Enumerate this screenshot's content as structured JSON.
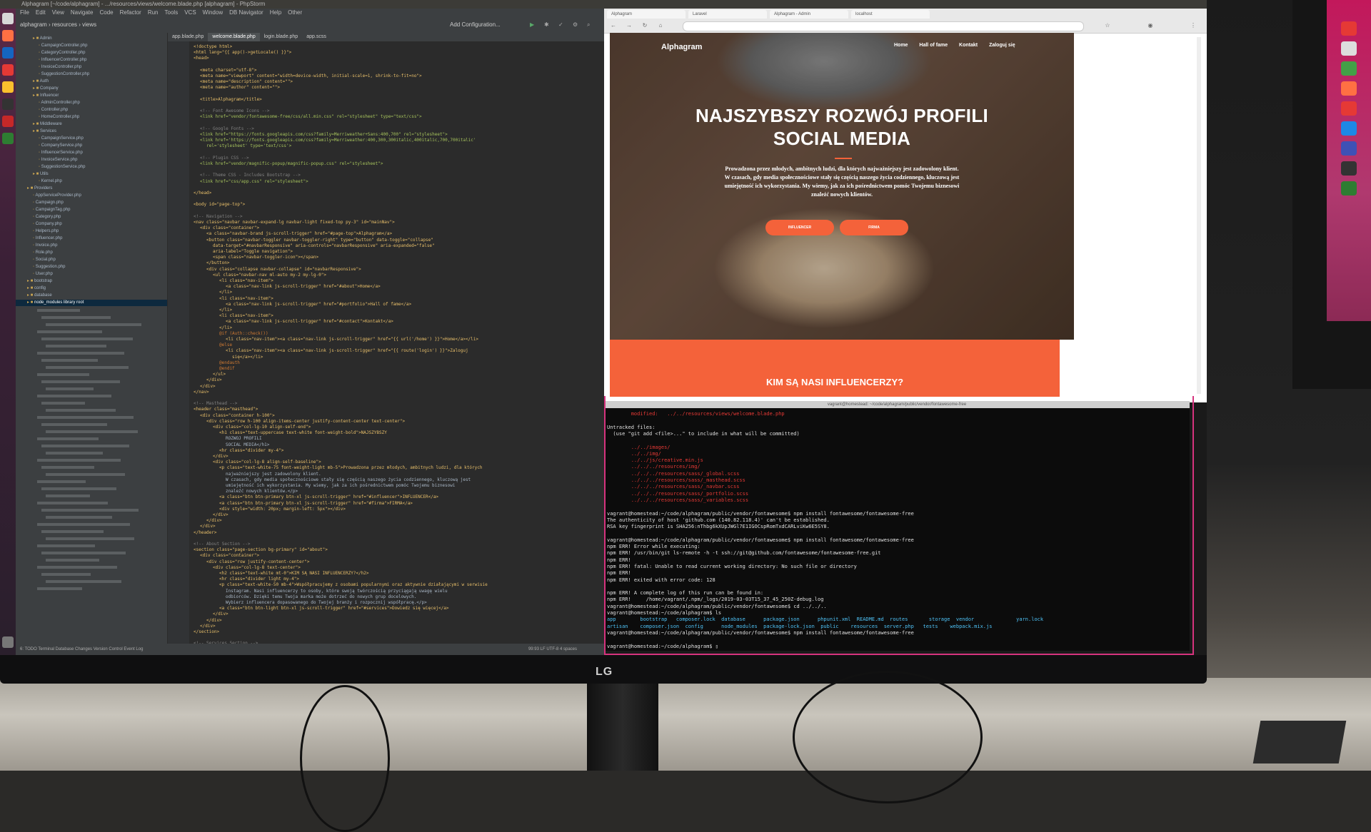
{
  "desktop": {
    "top_bar": "Alphagram [~/code/alphagram] - .../resources/views/welcome.blade.php [alphagram] - PhpStorm"
  },
  "ide": {
    "menu": [
      "File",
      "Edit",
      "View",
      "Navigate",
      "Code",
      "Refactor",
      "Run",
      "Tools",
      "VCS",
      "Window",
      "DB Navigator",
      "Help",
      "Other"
    ],
    "breadcrumb": "alphagram › resources › views",
    "run_config": "Add Configuration...",
    "tabs": [
      "app.blade.php",
      "welcome.blade.php",
      "login.blade.php",
      "app.scss"
    ],
    "project_tree": [
      {
        "label": "Admin",
        "depth": 2,
        "folder": true
      },
      {
        "label": "CampaignController.php",
        "depth": 3
      },
      {
        "label": "CategoryController.php",
        "depth": 3
      },
      {
        "label": "InfluencerController.php",
        "depth": 3
      },
      {
        "label": "InvoiceController.php",
        "depth": 3
      },
      {
        "label": "SuggestionController.php",
        "depth": 3
      },
      {
        "label": "Auth",
        "depth": 2,
        "folder": true
      },
      {
        "label": "Company",
        "depth": 2,
        "folder": true
      },
      {
        "label": "Influencer",
        "depth": 2,
        "folder": true
      },
      {
        "label": "AdminController.php",
        "depth": 3
      },
      {
        "label": "Controller.php",
        "depth": 3
      },
      {
        "label": "HomeController.php",
        "depth": 3
      },
      {
        "label": "Middleware",
        "depth": 2,
        "folder": true
      },
      {
        "label": "Services",
        "depth": 2,
        "folder": true
      },
      {
        "label": "CampaignService.php",
        "depth": 3
      },
      {
        "label": "CompanyService.php",
        "depth": 3
      },
      {
        "label": "InfluencerService.php",
        "depth": 3
      },
      {
        "label": "InvoiceService.php",
        "depth": 3
      },
      {
        "label": "SuggestionService.php",
        "depth": 3
      },
      {
        "label": "Utils",
        "depth": 2,
        "folder": true
      },
      {
        "label": "Kernel.php",
        "depth": 3
      },
      {
        "label": "Providers",
        "depth": 1,
        "folder": true
      },
      {
        "label": "AppServiceProvider.php",
        "depth": 2
      },
      {
        "label": "Campaign.php",
        "depth": 2
      },
      {
        "label": "CampaignTag.php",
        "depth": 2
      },
      {
        "label": "Category.php",
        "depth": 2
      },
      {
        "label": "Company.php",
        "depth": 2
      },
      {
        "label": "Helpers.php",
        "depth": 2
      },
      {
        "label": "Influencer.php",
        "depth": 2
      },
      {
        "label": "Invoice.php",
        "depth": 2
      },
      {
        "label": "Role.php",
        "depth": 2
      },
      {
        "label": "Social.php",
        "depth": 2
      },
      {
        "label": "Suggestion.php",
        "depth": 2
      },
      {
        "label": "User.php",
        "depth": 2
      },
      {
        "label": "bootstrap",
        "depth": 1,
        "folder": true
      },
      {
        "label": "config",
        "depth": 1,
        "folder": true
      },
      {
        "label": "database",
        "depth": 1,
        "folder": true
      },
      {
        "label": "node_modules  library root",
        "depth": 1,
        "folder": true,
        "selected": true
      }
    ],
    "code_lines": [
      {
        "i": 0,
        "t": "<!doctype html>",
        "c": "#e8bf6a"
      },
      {
        "i": 0,
        "t": "<html lang=\"{{ app()->getLocale() }}\">",
        "c": "#e8bf6a"
      },
      {
        "i": 0,
        "t": "<head>",
        "c": "#e8bf6a"
      },
      {
        "i": 0,
        "t": "",
        "c": "#a9b7c6"
      },
      {
        "i": 1,
        "t": "<meta charset=\"utf-8\">",
        "c": "#e8bf6a"
      },
      {
        "i": 1,
        "t": "<meta name=\"viewport\" content=\"width=device-width, initial-scale=1, shrink-to-fit=no\">",
        "c": "#e8bf6a"
      },
      {
        "i": 1,
        "t": "<meta name=\"description\" content=\"\">",
        "c": "#e8bf6a"
      },
      {
        "i": 1,
        "t": "<meta name=\"author\" content=\"\">",
        "c": "#e8bf6a"
      },
      {
        "i": 0,
        "t": "",
        "c": "#a9b7c6"
      },
      {
        "i": 1,
        "t": "<title>Alphagram</title>",
        "c": "#e8bf6a"
      },
      {
        "i": 0,
        "t": "",
        "c": "#a9b7c6"
      },
      {
        "i": 1,
        "t": "<!-- Font Awesome Icons -->",
        "c": "#808080"
      },
      {
        "i": 1,
        "t": "<link href=\"vendor/fontawesome-free/css/all.min.css\" rel=\"stylesheet\" type=\"text/css\">",
        "c": "#a5c25c"
      },
      {
        "i": 0,
        "t": "",
        "c": "#a9b7c6"
      },
      {
        "i": 1,
        "t": "<!-- Google Fonts -->",
        "c": "#808080"
      },
      {
        "i": 1,
        "t": "<link href=\"https://fonts.googleapis.com/css?family=Merriweather+Sans:400,700\" rel=\"stylesheet\">",
        "c": "#a5c25c"
      },
      {
        "i": 1,
        "t": "<link href='https://fonts.googleapis.com/css?family=Merriweather:400,300,300italic,400italic,700,700italic'",
        "c": "#a5c25c"
      },
      {
        "i": 2,
        "t": "rel='stylesheet' type='text/css'>",
        "c": "#a5c25c"
      },
      {
        "i": 0,
        "t": "",
        "c": "#a9b7c6"
      },
      {
        "i": 1,
        "t": "<!-- Plugin CSS -->",
        "c": "#808080"
      },
      {
        "i": 1,
        "t": "<link href=\"vendor/magnific-popup/magnific-popup.css\" rel=\"stylesheet\">",
        "c": "#a5c25c"
      },
      {
        "i": 0,
        "t": "",
        "c": "#a9b7c6"
      },
      {
        "i": 1,
        "t": "<!-- Theme CSS - Includes Bootstrap -->",
        "c": "#808080"
      },
      {
        "i": 1,
        "t": "<link href=\"css/app.css\" rel=\"stylesheet\">",
        "c": "#a5c25c"
      },
      {
        "i": 0,
        "t": "",
        "c": "#a9b7c6"
      },
      {
        "i": 0,
        "t": "</head>",
        "c": "#e8bf6a"
      },
      {
        "i": 0,
        "t": "",
        "c": "#a9b7c6"
      },
      {
        "i": 0,
        "t": "<body id=\"page-top\">",
        "c": "#e8bf6a"
      },
      {
        "i": 0,
        "t": "",
        "c": "#a9b7c6"
      },
      {
        "i": 0,
        "t": "<!-- Navigation -->",
        "c": "#808080"
      },
      {
        "i": 0,
        "t": "<nav class=\"navbar navbar-expand-lg navbar-light fixed-top py-3\" id=\"mainNav\">",
        "c": "#e8bf6a"
      },
      {
        "i": 1,
        "t": "<div class=\"container\">",
        "c": "#e8bf6a"
      },
      {
        "i": 2,
        "t": "<a class=\"navbar-brand js-scroll-trigger\" href=\"#page-top\">Alphagram</a>",
        "c": "#e8bf6a"
      },
      {
        "i": 2,
        "t": "<button class=\"navbar-toggler navbar-toggler-right\" type=\"button\" data-toggle=\"collapse\"",
        "c": "#e8bf6a"
      },
      {
        "i": 3,
        "t": "data-target=\"#navbarResponsive\" aria-controls=\"navbarResponsive\" aria-expanded=\"false\"",
        "c": "#e8bf6a"
      },
      {
        "i": 3,
        "t": "aria-label=\"Toggle navigation\">",
        "c": "#e8bf6a"
      },
      {
        "i": 3,
        "t": "<span class=\"navbar-toggler-icon\"></span>",
        "c": "#e8bf6a"
      },
      {
        "i": 2,
        "t": "</button>",
        "c": "#e8bf6a"
      },
      {
        "i": 2,
        "t": "<div class=\"collapse navbar-collapse\" id=\"navbarResponsive\">",
        "c": "#e8bf6a"
      },
      {
        "i": 3,
        "t": "<ul class=\"navbar-nav ml-auto my-2 my-lg-0\">",
        "c": "#e8bf6a"
      },
      {
        "i": 4,
        "t": "<li class=\"nav-item\">",
        "c": "#e8bf6a"
      },
      {
        "i": 5,
        "t": "<a class=\"nav-link js-scroll-trigger\" href=\"#about\">Home</a>",
        "c": "#e8bf6a"
      },
      {
        "i": 4,
        "t": "</li>",
        "c": "#e8bf6a"
      },
      {
        "i": 4,
        "t": "<li class=\"nav-item\">",
        "c": "#e8bf6a"
      },
      {
        "i": 5,
        "t": "<a class=\"nav-link js-scroll-trigger\" href=\"#portfolio\">Hall of fame</a>",
        "c": "#e8bf6a"
      },
      {
        "i": 4,
        "t": "</li>",
        "c": "#e8bf6a"
      },
      {
        "i": 4,
        "t": "<li class=\"nav-item\">",
        "c": "#e8bf6a"
      },
      {
        "i": 5,
        "t": "<a class=\"nav-link js-scroll-trigger\" href=\"#contact\">Kontakt</a>",
        "c": "#e8bf6a"
      },
      {
        "i": 4,
        "t": "</li>",
        "c": "#e8bf6a"
      },
      {
        "i": 4,
        "t": "@if (Auth::check())",
        "c": "#cc7832"
      },
      {
        "i": 5,
        "t": "<li class=\"nav-item\"><a class=\"nav-link js-scroll-trigger\" href=\"{{ url('/home') }}\">Home</a></li>",
        "c": "#e8bf6a"
      },
      {
        "i": 4,
        "t": "@else",
        "c": "#cc7832"
      },
      {
        "i": 5,
        "t": "<li class=\"nav-item\"><a class=\"nav-link js-scroll-trigger\" href=\"{{ route('login') }}\">Zaloguj",
        "c": "#e8bf6a"
      },
      {
        "i": 6,
        "t": "się</a></li>",
        "c": "#e8bf6a"
      },
      {
        "i": 4,
        "t": "@endauth",
        "c": "#cc7832"
      },
      {
        "i": 4,
        "t": "@endif",
        "c": "#cc7832"
      },
      {
        "i": 3,
        "t": "</ul>",
        "c": "#e8bf6a"
      },
      {
        "i": 2,
        "t": "</div>",
        "c": "#e8bf6a"
      },
      {
        "i": 1,
        "t": "</div>",
        "c": "#e8bf6a"
      },
      {
        "i": 0,
        "t": "</nav>",
        "c": "#e8bf6a"
      },
      {
        "i": 0,
        "t": "",
        "c": "#a9b7c6"
      },
      {
        "i": 0,
        "t": "<!-- Masthead -->",
        "c": "#808080"
      },
      {
        "i": 0,
        "t": "<header class=\"masthead\">",
        "c": "#e8bf6a"
      },
      {
        "i": 1,
        "t": "<div class=\"container h-100\">",
        "c": "#e8bf6a"
      },
      {
        "i": 2,
        "t": "<div class=\"row h-100 align-items-center justify-content-center text-center\">",
        "c": "#e8bf6a"
      },
      {
        "i": 3,
        "t": "<div class=\"col-lg-10 align-self-end\">",
        "c": "#e8bf6a"
      },
      {
        "i": 4,
        "t": "<h1 class=\"text-uppercase text-white font-weight-bold\">NAJSZYBSZY",
        "c": "#e8bf6a"
      },
      {
        "i": 5,
        "t": "ROZWÓJ PROFILI",
        "c": "#a9b7c6"
      },
      {
        "i": 5,
        "t": "SOCIAL MEDIA</h1>",
        "c": "#a9b7c6"
      },
      {
        "i": 4,
        "t": "<hr class=\"divider my-4\">",
        "c": "#e8bf6a"
      },
      {
        "i": 3,
        "t": "</div>",
        "c": "#e8bf6a"
      },
      {
        "i": 3,
        "t": "<div class=\"col-lg-8 align-self-baseline\">",
        "c": "#e8bf6a"
      },
      {
        "i": 4,
        "t": "<p class=\"text-white-75 font-weight-light mb-5\">Prowadzona przez młodych, ambitnych ludzi, dla których",
        "c": "#e8bf6a"
      },
      {
        "i": 5,
        "t": "najważniejszy jest zadowolony klient.",
        "c": "#a9b7c6"
      },
      {
        "i": 5,
        "t": "W czasach, gdy media społecznościowe stały się częścią naszego życia codziennego, kluczową jest",
        "c": "#a9b7c6"
      },
      {
        "i": 5,
        "t": "umiejętność ich wykorzystania. My wiemy, jak za ich pośrednictwem pomóc Twojemu biznesowi",
        "c": "#a9b7c6"
      },
      {
        "i": 5,
        "t": "znaleźć nowych klientów.</p>",
        "c": "#a9b7c6"
      },
      {
        "i": 4,
        "t": "<a class=\"btn btn-primary btn-xl js-scroll-trigger\" href=\"#influencer\">INFLUENCER</a>",
        "c": "#e8bf6a"
      },
      {
        "i": 4,
        "t": "<a class=\"btn btn-primary btn-xl js-scroll-trigger\" href=\"#firma\">FIRMA</a>",
        "c": "#e8bf6a"
      },
      {
        "i": 4,
        "t": "<div style=\"width: 20px; margin-left: 5px\"></div>",
        "c": "#e8bf6a"
      },
      {
        "i": 3,
        "t": "</div>",
        "c": "#e8bf6a"
      },
      {
        "i": 2,
        "t": "</div>",
        "c": "#e8bf6a"
      },
      {
        "i": 1,
        "t": "</div>",
        "c": "#e8bf6a"
      },
      {
        "i": 0,
        "t": "</header>",
        "c": "#e8bf6a"
      },
      {
        "i": 0,
        "t": "",
        "c": "#a9b7c6"
      },
      {
        "i": 0,
        "t": "<!-- About Section -->",
        "c": "#808080"
      },
      {
        "i": 0,
        "t": "<section class=\"page-section bg-primary\" id=\"about\">",
        "c": "#e8bf6a"
      },
      {
        "i": 1,
        "t": "<div class=\"container\">",
        "c": "#e8bf6a"
      },
      {
        "i": 2,
        "t": "<div class=\"row justify-content-center\">",
        "c": "#e8bf6a"
      },
      {
        "i": 3,
        "t": "<div class=\"col-lg-8 text-center\">",
        "c": "#e8bf6a"
      },
      {
        "i": 4,
        "t": "<h2 class=\"text-white mt-0\">KIM SĄ NASI INFLUENCERZY?</h2>",
        "c": "#e8bf6a"
      },
      {
        "i": 4,
        "t": "<hr class=\"divider light my-4\">",
        "c": "#e8bf6a"
      },
      {
        "i": 4,
        "t": "<p class=\"text-white-50 mb-4\">Współpracujemy z osobami popularnymi oraz aktywnie działającymi w serwisie",
        "c": "#e8bf6a"
      },
      {
        "i": 5,
        "t": "Instagram. Nasi influencerzy to osoby, które swoją twórczością przyciągają uwagę wielu",
        "c": "#a9b7c6"
      },
      {
        "i": 5,
        "t": "odbiorców. Dzięki temu Twoja marka może dotrzeć do nowych grup docelowych.",
        "c": "#a9b7c6"
      },
      {
        "i": 5,
        "t": "Wybierz influencera dopasowanego do Twojej branży i rozpocznij współpracę.</p>",
        "c": "#a9b7c6"
      },
      {
        "i": 4,
        "t": "<a class=\"btn btn-light btn-xl js-scroll-trigger\" href=\"#services\">Dowiedz się więcej</a>",
        "c": "#e8bf6a"
      },
      {
        "i": 3,
        "t": "</div>",
        "c": "#e8bf6a"
      },
      {
        "i": 2,
        "t": "</div>",
        "c": "#e8bf6a"
      },
      {
        "i": 1,
        "t": "</div>",
        "c": "#e8bf6a"
      },
      {
        "i": 0,
        "t": "</section>",
        "c": "#e8bf6a"
      },
      {
        "i": 0,
        "t": "",
        "c": "#a9b7c6"
      },
      {
        "i": 0,
        "t": "<!-- Services Section -->",
        "c": "#808080"
      },
      {
        "i": 0,
        "t": "<section class=\"page-section\" id=\"services\">",
        "c": "#e8bf6a"
      }
    ],
    "status_bar": "6: TODO   Terminal   Database Changes   Version Control   Event Log",
    "status_right": "99:93  LF  UTF-8  4 spaces"
  },
  "browser": {
    "tabs": [
      "Alphagram",
      "Laravel",
      "Alphagram - Admin",
      "localhost"
    ],
    "site": {
      "brand": "Alphagram",
      "nav": [
        "Home",
        "Hall of fame",
        "Kontakt",
        "Zaloguj się"
      ],
      "hero_title": "NAJSZYBSZY ROZWÓJ PROFILI SOCIAL MEDIA",
      "hero_text": "Prowadzona przez młodych, ambitnych ludzi, dla których najważniejszy jest zadowolony klient. W czasach, gdy media społecznościowe stały się częścią naszego życia codziennego, kluczową jest umiejętność ich wykorzystania. My wiemy, jak za ich pośrednictwem pomóc Twojemu biznesowi znaleźć nowych klientów.",
      "buttons": [
        "INFLUENCER",
        "FIRMA"
      ],
      "section_title": "KIM SĄ NASI INFLUENCERZY?"
    }
  },
  "terminal": {
    "title": "vagrant@homestead: ~/code/alphagram/public/vendor/fontawesome-free",
    "lines": [
      {
        "t": "        modified:   ../../resources/views/welcome.blade.php",
        "c": "#e53935"
      },
      {
        "t": "",
        "c": "#e0e0e0"
      },
      {
        "t": "Untracked files:",
        "c": "#e0e0e0"
      },
      {
        "t": "  (use \"git add <file>...\" to include in what will be committed)",
        "c": "#e0e0e0"
      },
      {
        "t": "",
        "c": "#e0e0e0"
      },
      {
        "t": "        ../../images/",
        "c": "#e53935"
      },
      {
        "t": "        ../../img/",
        "c": "#e53935"
      },
      {
        "t": "        ../../js/creative.min.js",
        "c": "#e53935"
      },
      {
        "t": "        ../../../resources/img/",
        "c": "#e53935"
      },
      {
        "t": "        ../../../resources/sass/_global.scss",
        "c": "#e53935"
      },
      {
        "t": "        ../../../resources/sass/_masthead.scss",
        "c": "#e53935"
      },
      {
        "t": "        ../../../resources/sass/_navbar.scss",
        "c": "#e53935"
      },
      {
        "t": "        ../../../resources/sass/_portfolio.scss",
        "c": "#e53935"
      },
      {
        "t": "        ../../../resources/sass/_variables.scss",
        "c": "#e53935"
      },
      {
        "t": "",
        "c": "#e0e0e0"
      },
      {
        "t": "vagrant@homestead:~/code/alphagram/public/vendor/fontawesome$ npm install fontawesome/fontawesome-free",
        "c": "#e0e0e0"
      },
      {
        "t": "The authenticity of host 'github.com (140.82.118.4)' can't be established.",
        "c": "#e0e0e0"
      },
      {
        "t": "RSA key fingerprint is SHA256:nThbg6kXUpJWGl7E1IGOCspRomTxdCARLviKw6E5SY8.",
        "c": "#e0e0e0"
      },
      {
        "t": "",
        "c": "#e0e0e0"
      },
      {
        "t": "vagrant@homestead:~/code/alphagram/public/vendor/fontawesome$ npm install fontawesome/fontawesome-free",
        "c": "#e0e0e0"
      },
      {
        "t": "npm ERR! Error while executing:",
        "c": "#e0e0e0"
      },
      {
        "t": "npm ERR! /usr/bin/git ls-remote -h -t ssh://git@github.com/fontawesome/fontawesome-free.git",
        "c": "#e0e0e0"
      },
      {
        "t": "npm ERR!",
        "c": "#e0e0e0"
      },
      {
        "t": "npm ERR! fatal: Unable to read current working directory: No such file or directory",
        "c": "#e0e0e0"
      },
      {
        "t": "npm ERR!",
        "c": "#e0e0e0"
      },
      {
        "t": "npm ERR! exited with error code: 128",
        "c": "#e0e0e0"
      },
      {
        "t": "",
        "c": "#e0e0e0"
      },
      {
        "t": "npm ERR! A complete log of this run can be found in:",
        "c": "#e0e0e0"
      },
      {
        "t": "npm ERR!     /home/vagrant/.npm/_logs/2019-03-03T15_37_45_250Z-debug.log",
        "c": "#e0e0e0"
      },
      {
        "t": "vagrant@homestead:~/code/alphagram/public/vendor/fontawesome$ cd ../../..",
        "c": "#e0e0e0"
      },
      {
        "t": "vagrant@homestead:~/code/alphagram$ ls",
        "c": "#e0e0e0"
      },
      {
        "t": "app        bootstrap   composer.lock  database      package.json      phpunit.xml  README.md  routes       storage  vendor              yarn.lock",
        "c": "#4fc3f7"
      },
      {
        "t": "artisan    composer.json  config      node_modules  package-lock.json  public    resources  server.php   tests    webpack.mix.js",
        "c": "#4fc3f7"
      },
      {
        "t": "vagrant@homestead:~/code/alphagram/public/vendor/fontawesome$ npm install fontawesome/fontawesome-free",
        "c": "#e0e0e0"
      },
      {
        "t": "",
        "c": "#e0e0e0"
      },
      {
        "t": "vagrant@homestead:~/code/alphagram$ ▯",
        "c": "#e0e0e0"
      }
    ]
  },
  "monitor": {
    "brand": "LG"
  },
  "colors": {
    "accent": "#f4623a",
    "terminal_error": "#e53935",
    "ubuntu": "#c2185b"
  }
}
